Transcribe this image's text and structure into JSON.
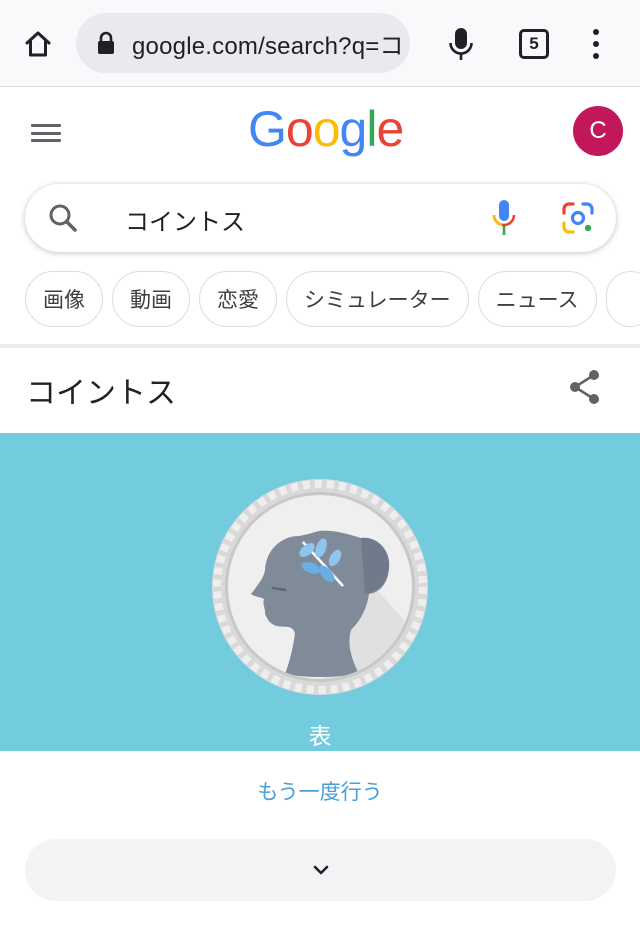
{
  "browser": {
    "url": "google.com/search?q=コ",
    "tab_count": "5"
  },
  "google": {
    "logo_letters": [
      {
        "char": "G",
        "color": "#4285F4"
      },
      {
        "char": "o",
        "color": "#EA4335"
      },
      {
        "char": "o",
        "color": "#FBBC05"
      },
      {
        "char": "g",
        "color": "#4285F4"
      },
      {
        "char": "l",
        "color": "#34A853"
      },
      {
        "char": "e",
        "color": "#EA4335"
      }
    ],
    "avatar_letter": "C",
    "avatar_color": "#C2185B"
  },
  "search": {
    "query": "コイントス"
  },
  "chips": [
    "画像",
    "動画",
    "恋愛",
    "シミュレーター",
    "ニュース"
  ],
  "coin_toss": {
    "title": "コイントス",
    "result": "表",
    "retry_label": "もう一度行う",
    "background_color": "#73CBDE"
  },
  "icons": {
    "home": "home-icon",
    "lock": "lock-icon",
    "mic": "mic-icon",
    "menu": "kebab-menu-icon",
    "hamburger": "hamburger-icon",
    "search": "search-icon",
    "voice": "voice-search-icon",
    "lens": "google-lens-icon",
    "share": "share-icon",
    "chevron": "chevron-down-icon"
  }
}
